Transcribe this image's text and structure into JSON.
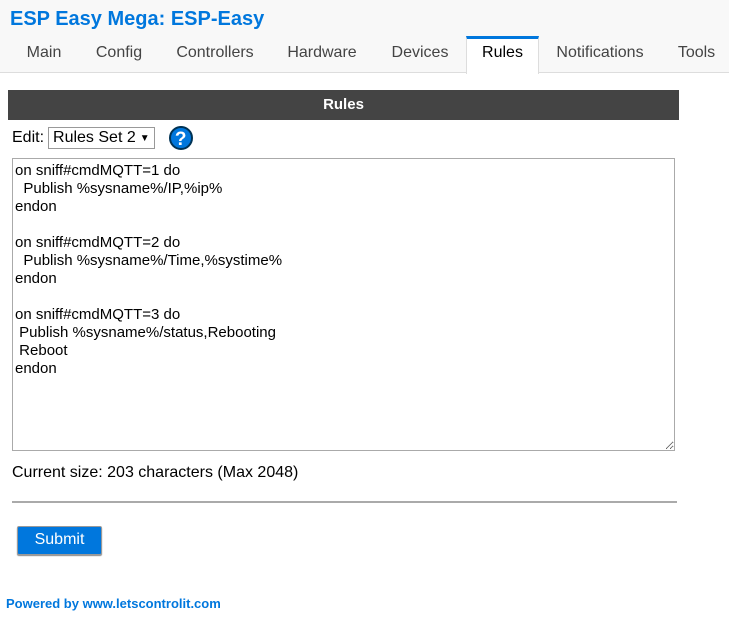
{
  "header": {
    "title": "ESP Easy Mega: ESP-Easy"
  },
  "tabs": [
    {
      "label": "Main"
    },
    {
      "label": "Config"
    },
    {
      "label": "Controllers"
    },
    {
      "label": "Hardware"
    },
    {
      "label": "Devices"
    },
    {
      "label": "Rules",
      "active": true
    },
    {
      "label": "Notifications"
    },
    {
      "label": "Tools"
    }
  ],
  "section": {
    "title": "Rules"
  },
  "edit": {
    "label": "Edit:",
    "selected": "Rules Set 2",
    "help": "?"
  },
  "rules_text": "on sniff#cmdMQTT=1 do\n  Publish %sysname%/IP,%ip%\nendon\n\non sniff#cmdMQTT=2 do\n  Publish %sysname%/Time,%systime%\nendon\n\non sniff#cmdMQTT=3 do\n Publish %sysname%/status,Rebooting\n Reboot\nendon",
  "size_text": "Current size: 203 characters (Max 2048)",
  "submit_label": "Submit",
  "footer": "Powered by www.letscontrolit.com",
  "colors": {
    "accent": "#0077dd",
    "bar": "#444444"
  }
}
